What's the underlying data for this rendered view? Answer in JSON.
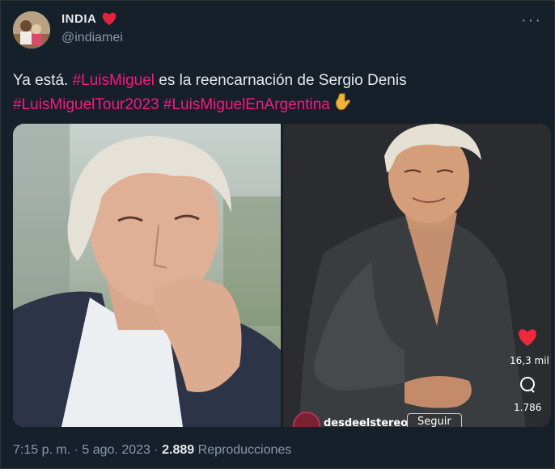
{
  "author": {
    "display_name": "INDIA",
    "handle": "@indiamei"
  },
  "tweet": {
    "text_1": "Ya está. ",
    "hashtag_1": "#LuisMiguel",
    "text_2": " es la reencarnación de Sergio Denis",
    "hashtag_2": "#LuisMiguelTour2023",
    "hashtag_3": "#LuisMiguelEnArgentina"
  },
  "media_overlay": {
    "likes": "16,3 mil",
    "comments": "1.786",
    "channel": "desdeelstereo",
    "follow_label": "Seguir"
  },
  "meta": {
    "time": "7:15 p. m.",
    "date": "5 ago. 2023",
    "views": "2.889",
    "views_label": "Reproducciones",
    "separator": "·"
  },
  "colors": {
    "background": "#15202b",
    "hashtag": "#f91880",
    "muted": "#8b98a5",
    "text": "#e7e9ea"
  },
  "icons": {
    "heart": "red-heart-icon",
    "point_down": "point-down-emoji",
    "more": "more-options-icon",
    "like": "like-heart-icon",
    "comment": "comment-bubble-icon"
  }
}
